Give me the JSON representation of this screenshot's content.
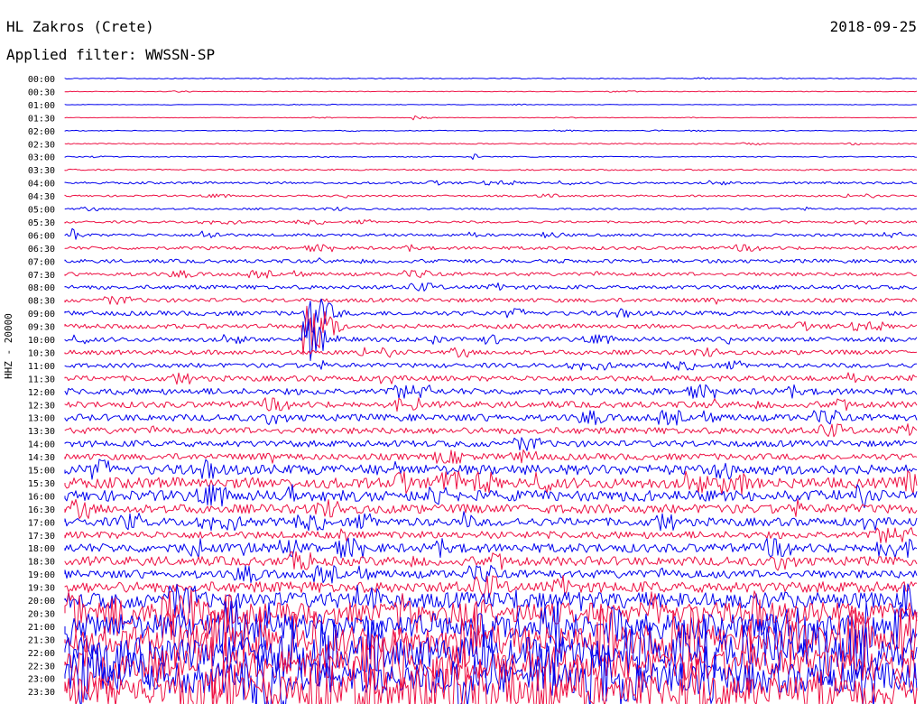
{
  "header": {
    "station": "HL Zakros (Crete)",
    "date": "2018-09-25",
    "filter": "Applied filter: WWSSN-SP"
  },
  "channel_label": "HHZ - 20000",
  "colors": {
    "blue": "#0000ee",
    "red": "#ee1144",
    "text": "#000000"
  },
  "chart_data": {
    "type": "line",
    "title": "HL Zakros (Crete)",
    "subtitle": "Applied filter: WWSSN-SP",
    "ylabel": "HHZ - 20000",
    "xlabel": "",
    "grid": false,
    "legend": "none",
    "row_labels": [
      "00:00",
      "00:30",
      "01:00",
      "01:30",
      "02:00",
      "02:30",
      "03:00",
      "03:30",
      "04:00",
      "04:30",
      "05:00",
      "05:30",
      "06:00",
      "06:30",
      "07:00",
      "07:30",
      "08:00",
      "08:30",
      "09:00",
      "09:30",
      "10:00",
      "10:30",
      "11:00",
      "11:30",
      "12:00",
      "12:30",
      "13:00",
      "13:30",
      "14:00",
      "14:30",
      "15:00",
      "15:30",
      "16:00",
      "16:30",
      "17:00",
      "17:30",
      "18:00",
      "18:30",
      "19:00",
      "19:30",
      "20:00",
      "20:30",
      "21:00",
      "21:30",
      "22:00",
      "22:30",
      "23:00",
      "23:30"
    ],
    "series_color_pattern": [
      "blue",
      "red"
    ],
    "noise_amplitude": [
      0.5,
      0.4,
      0.3,
      0.3,
      0.4,
      0.6,
      0.5,
      0.8,
      1.2,
      1.0,
      1.0,
      1.2,
      1.5,
      1.8,
      2.0,
      2.0,
      2.2,
      2.2,
      2.5,
      2.5,
      2.5,
      2.5,
      2.5,
      3.0,
      3.5,
      3.5,
      3.8,
      3.5,
      3.5,
      3.5,
      5.5,
      6.0,
      6.0,
      5.0,
      4.5,
      4.0,
      5.0,
      5.0,
      4.5,
      6.0,
      9.0,
      12.0,
      14.0,
      16.0,
      17.0,
      17.0,
      17.0,
      17.0
    ],
    "events": [
      {
        "row": 3,
        "time_fraction": 0.41,
        "amplitude": 3,
        "duration_fraction": 0.03
      },
      {
        "row": 6,
        "time_fraction": 0.48,
        "amplitude": 4,
        "duration_fraction": 0.01
      },
      {
        "row": 12,
        "time_fraction": 0.01,
        "amplitude": 8,
        "duration_fraction": 0.02
      },
      {
        "row": 12,
        "time_fraction": 0.16,
        "amplitude": 6,
        "duration_fraction": 0.05
      },
      {
        "row": 18,
        "time_fraction": 0.28,
        "amplitude": 30,
        "duration_fraction": 0.05
      },
      {
        "row": 19,
        "time_fraction": 0.28,
        "amplitude": 40,
        "duration_fraction": 0.05
      },
      {
        "row": 20,
        "time_fraction": 0.28,
        "amplitude": 30,
        "duration_fraction": 0.04
      },
      {
        "row": 34,
        "time_fraction": 0.47,
        "amplitude": 12,
        "duration_fraction": 0.02
      },
      {
        "row": 36,
        "time_fraction": 0.21,
        "amplitude": 10,
        "duration_fraction": 0.02
      }
    ]
  }
}
